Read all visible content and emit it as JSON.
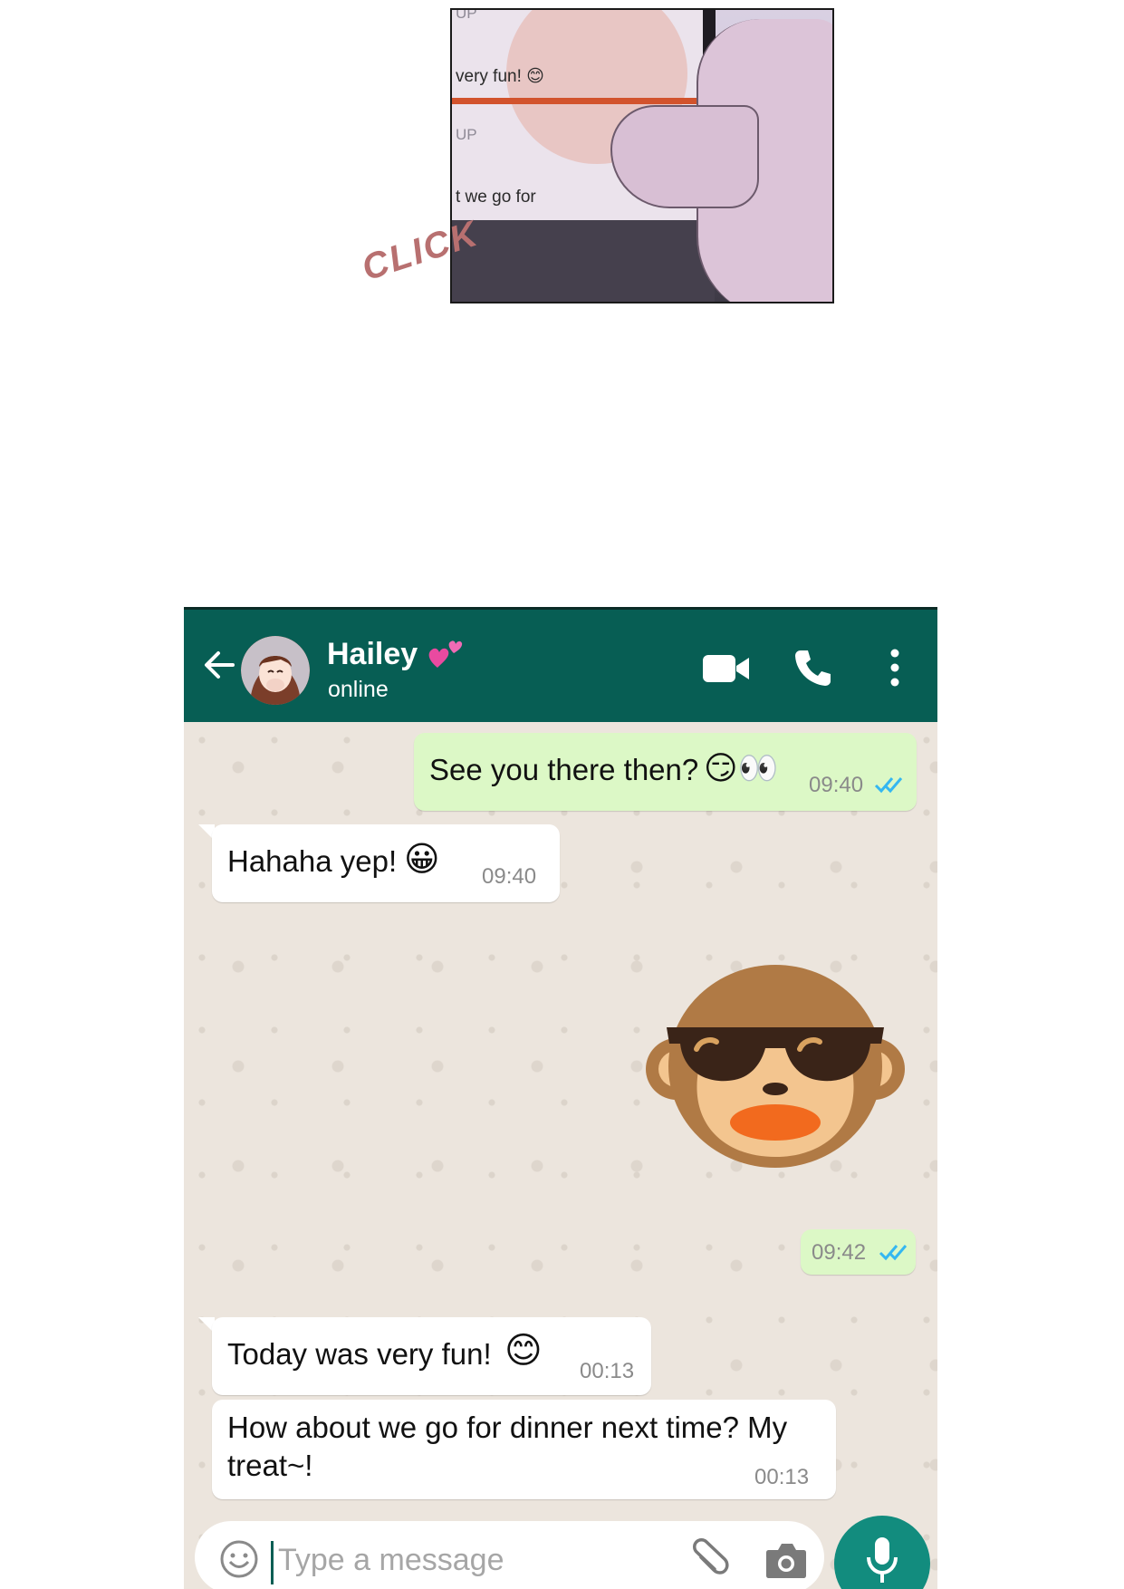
{
  "comic": {
    "lines": [
      "UP",
      "very fun! 😊",
      "UP",
      "t we go for"
    ],
    "sound_effect": "CLICK"
  },
  "header": {
    "contact_name": "Hailey",
    "status": "online"
  },
  "messages": [
    {
      "direction": "out",
      "text": "See you there then?",
      "emoji": "😏👀",
      "time": "09:40",
      "read": true
    },
    {
      "direction": "in",
      "text": "Hahaha yep!",
      "emoji": "😀",
      "time": "09:40"
    },
    {
      "direction": "out",
      "sticker": "monkey-sunglasses-sticker",
      "time": "09:42",
      "read": true
    },
    {
      "direction": "in",
      "text": "Today was very fun!",
      "emoji": "😊",
      "time": "00:13"
    },
    {
      "direction": "in",
      "text_line1": "How about we go for dinner next time? My",
      "text_line2": "treat~!",
      "time": "00:13"
    }
  ],
  "composer": {
    "placeholder": "Type a message"
  },
  "colors": {
    "header": "#075e54",
    "outgoing_bubble": "#dcf8c6",
    "incoming_bubble": "#ffffff",
    "chat_background": "#ece5dd",
    "mic_button": "#128c7e",
    "read_ticks": "#34b7f1"
  },
  "icons": [
    "back-arrow-icon",
    "video-call-icon",
    "phone-icon",
    "more-options-icon",
    "emoji-icon",
    "attach-icon",
    "camera-icon",
    "mic-icon",
    "double-check-icon"
  ]
}
